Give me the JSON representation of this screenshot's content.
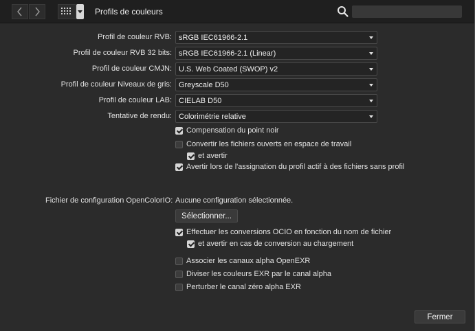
{
  "window": {
    "title": "Profils de couleurs"
  },
  "toolbar": {
    "back_icon": "chevron-left-icon",
    "forward_icon": "chevron-right-icon",
    "grid_icon": "grid-icon",
    "search_icon": "search-icon"
  },
  "profiles": [
    {
      "label": "Profil de couleur RVB:",
      "value": "sRGB IEC61966-2.1"
    },
    {
      "label": "Profil de couleur RVB 32 bits:",
      "value": "sRGB IEC61966-2.1 (Linear)"
    },
    {
      "label": "Profil de couleur CMJN:",
      "value": "U.S. Web Coated (SWOP) v2"
    },
    {
      "label": "Profil de couleur Niveaux de gris:",
      "value": "Greyscale D50"
    },
    {
      "label": "Profil de couleur LAB:",
      "value": "CIELAB D50"
    },
    {
      "label": "Tentative de rendu:",
      "value": "Colorimétrie relative"
    }
  ],
  "options": [
    {
      "label": "Compensation du point noir",
      "checked": true
    },
    {
      "label": "Convertir les fichiers ouverts en espace de travail",
      "checked": false
    },
    {
      "label": "et avertir",
      "checked": true
    },
    {
      "label": "Avertir lors de l'assignation du profil actif à des fichiers sans profil",
      "checked": true
    }
  ],
  "ocio": {
    "label": "Fichier de configuration OpenColorIO:",
    "value": "Aucune configuration sélectionnée.",
    "select_button": "Sélectionner...",
    "options": [
      {
        "label": "Effectuer les conversions OCIO en fonction du nom de fichier",
        "checked": true
      },
      {
        "label": "et avertir en cas de conversion au chargement",
        "checked": true
      }
    ]
  },
  "exr": [
    {
      "label": "Associer les canaux alpha OpenEXR",
      "checked": false
    },
    {
      "label": "Diviser les couleurs EXR par le canal alpha",
      "checked": false
    },
    {
      "label": "Perturber le canal zéro alpha EXR",
      "checked": false
    }
  ],
  "footer": {
    "close_button": "Fermer"
  }
}
